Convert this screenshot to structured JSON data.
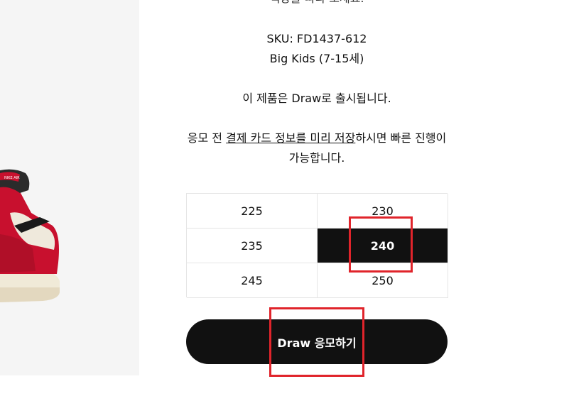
{
  "product": {
    "top_cut_text": "색상을 따라 보세요.",
    "sku": "SKU: FD1437-612",
    "size_group": "Big Kids (7-15세)",
    "draw_notice": "이 제품은 Draw로 출시됩니다.",
    "payment_prefix": "응모 전 ",
    "payment_link": "결제 카드 정보를 미리 저장",
    "payment_suffix": "하시면 빠른 진행이",
    "payment_line2": "가능합니다."
  },
  "sizes": [
    {
      "label": "225",
      "selected": false
    },
    {
      "label": "230",
      "selected": false
    },
    {
      "label": "235",
      "selected": false
    },
    {
      "label": "240",
      "selected": true
    },
    {
      "label": "245",
      "selected": false
    },
    {
      "label": "250",
      "selected": false
    }
  ],
  "draw_button": {
    "label": "Draw 응모하기"
  },
  "image": {
    "subject": "red-white-black-high-top-sneaker"
  },
  "colors": {
    "highlight": "#e0242b",
    "primary": "#111111"
  }
}
